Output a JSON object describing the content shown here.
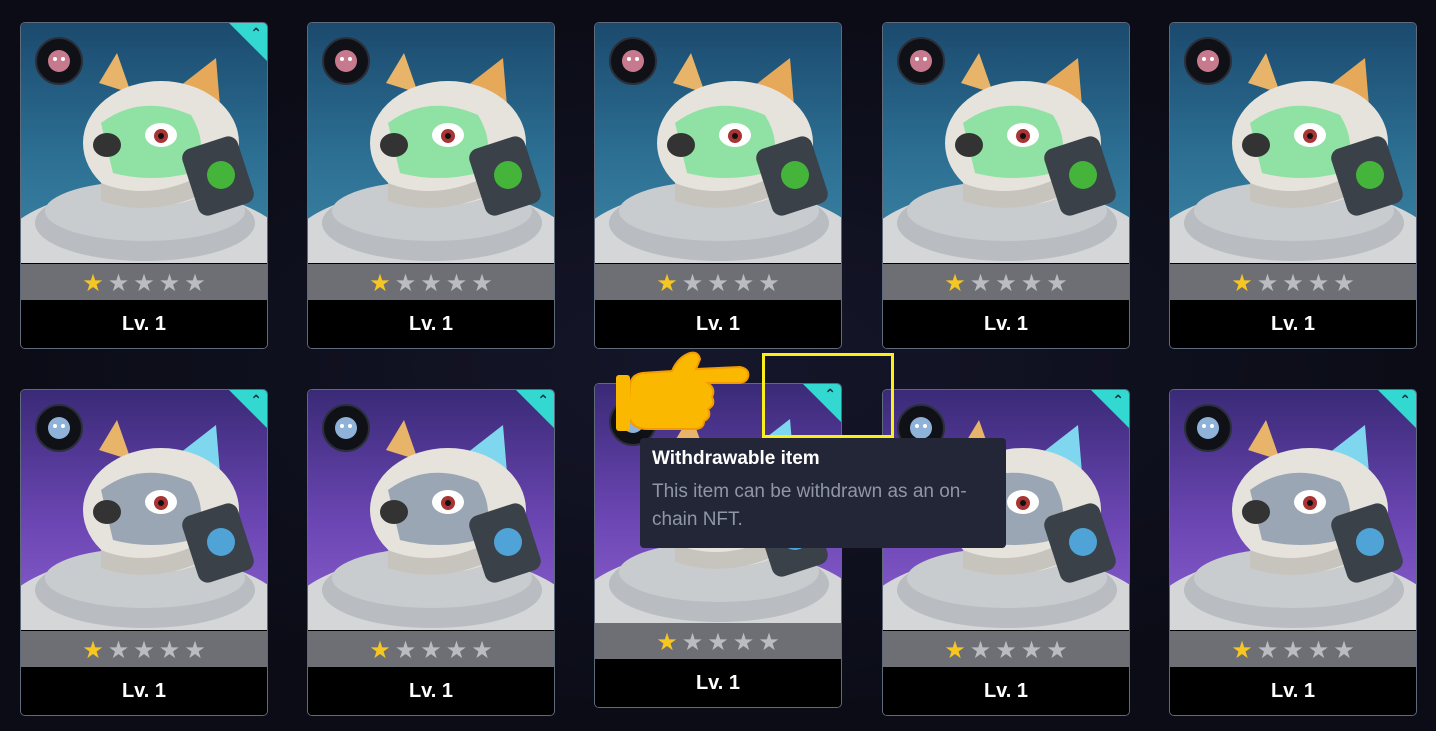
{
  "cards": [
    {
      "row": "top",
      "level": "Lv. 1",
      "stars": 1,
      "max_stars": 5,
      "withdrawable": true
    },
    {
      "row": "top",
      "level": "Lv. 1",
      "stars": 1,
      "max_stars": 5,
      "withdrawable": false
    },
    {
      "row": "top",
      "level": "Lv. 1",
      "stars": 1,
      "max_stars": 5,
      "withdrawable": false
    },
    {
      "row": "top",
      "level": "Lv. 1",
      "stars": 1,
      "max_stars": 5,
      "withdrawable": false
    },
    {
      "row": "top",
      "level": "Lv. 1",
      "stars": 1,
      "max_stars": 5,
      "withdrawable": false
    },
    {
      "row": "bottom",
      "level": "Lv. 1",
      "stars": 1,
      "max_stars": 5,
      "withdrawable": true
    },
    {
      "row": "bottom",
      "level": "Lv. 1",
      "stars": 1,
      "max_stars": 5,
      "withdrawable": true
    },
    {
      "row": "bottom",
      "level": "Lv. 1",
      "stars": 1,
      "max_stars": 5,
      "withdrawable": true
    },
    {
      "row": "bottom",
      "level": "Lv. 1",
      "stars": 1,
      "max_stars": 5,
      "withdrawable": true
    },
    {
      "row": "bottom",
      "level": "Lv. 1",
      "stars": 1,
      "max_stars": 5,
      "withdrawable": true
    }
  ],
  "tooltip": {
    "title": "Withdrawable item",
    "body": "This item can be withdrawn as an on-chain NFT."
  },
  "icons": {
    "withdraw_badge": "chevron-up-icon",
    "star": "star-icon",
    "pointer": "pointing-hand-icon"
  },
  "colors": {
    "withdraw_badge": "#33d8d0",
    "star_on": "#f6c623",
    "star_off": "#b9bcc2",
    "highlight": "#f8ef1c",
    "top_row_bg": "#2c6f93",
    "bottom_row_bg": "#6b46b3"
  }
}
